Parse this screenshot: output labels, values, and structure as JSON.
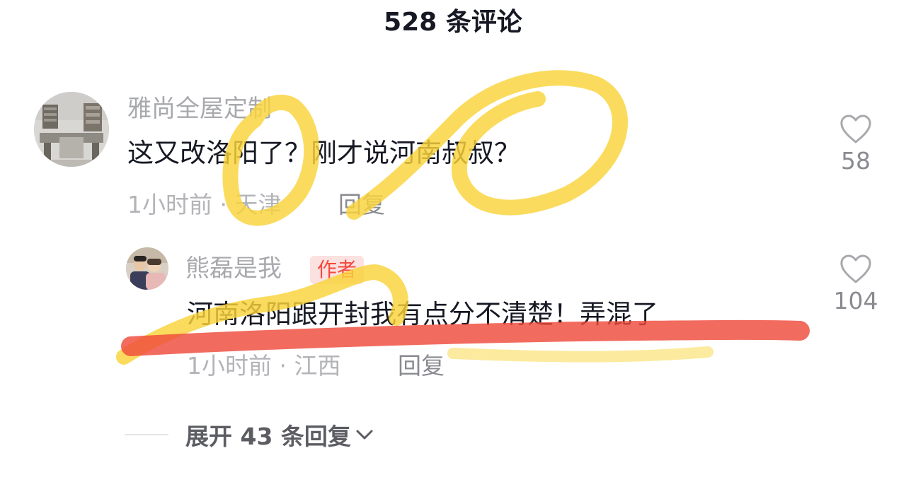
{
  "header": {
    "title": "528 条评论"
  },
  "comments": [
    {
      "username": "雅尚全屋定制",
      "text": "这又改洛阳了？刚才说河南叔叔？",
      "time": "1小时前",
      "location": "天津",
      "time_location": "1小时前 · 天津",
      "reply_label": "回复",
      "likes": "58"
    }
  ],
  "replies": [
    {
      "username": "熊磊是我",
      "badge": "作者",
      "text": "河南洛阳跟开封我有点分不清楚！弄混了",
      "time": "1小时前",
      "location": "江西",
      "time_location": "1小时前 · 江西",
      "reply_label": "回复",
      "likes": "104"
    }
  ],
  "expand": {
    "label": "展开 43 条回复"
  },
  "colors": {
    "text_primary": "#161823",
    "text_secondary": "#a8a9ad",
    "author_badge_bg": "#fbe1df",
    "author_badge_text": "#f5483c",
    "highlighter_yellow": "#f9d43a",
    "highlighter_red": "#ef4a3c"
  },
  "icons": {
    "like": "heart-outline-icon",
    "expand": "chevron-down-icon"
  }
}
